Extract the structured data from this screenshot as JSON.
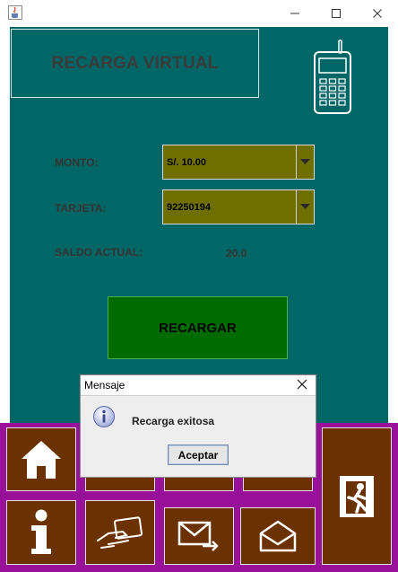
{
  "window": {
    "icon": "java-cup-icon",
    "controls": [
      "minimize-icon",
      "maximize-icon",
      "close-icon"
    ]
  },
  "header": {
    "title": "RECARGA VIRTUAL",
    "icon": "mobile-phone-icon"
  },
  "form": {
    "monto_label": "MONTO:",
    "monto_value": "S/. 10.00",
    "tarjeta_label": "TARJETA:",
    "tarjeta_value": "92250194",
    "saldo_label": "SALDO ACTUAL:",
    "saldo_value": "20.0",
    "recargar_label": "RECARGAR"
  },
  "nav": {
    "tiles": [
      {
        "icon": "home-icon"
      },
      {
        "icon": "transfer-icon"
      },
      {
        "icon": "cart-icon"
      },
      {
        "icon": "card-icon"
      },
      {
        "icon": "exit-icon"
      },
      {
        "icon": "info-icon"
      },
      {
        "icon": "card-payment-icon"
      },
      {
        "icon": "send-mail-icon"
      },
      {
        "icon": "open-mail-icon"
      }
    ]
  },
  "dialog": {
    "title": "Mensaje",
    "message": "Recarga exitosa",
    "button": "Aceptar",
    "icon": "info-icon"
  },
  "colors": {
    "main_bg": "#006666",
    "combo_bg": "#6f6f00",
    "button_bg": "#006b00",
    "nav_bg": "#9a1199",
    "tile_bg": "#6b3200"
  }
}
